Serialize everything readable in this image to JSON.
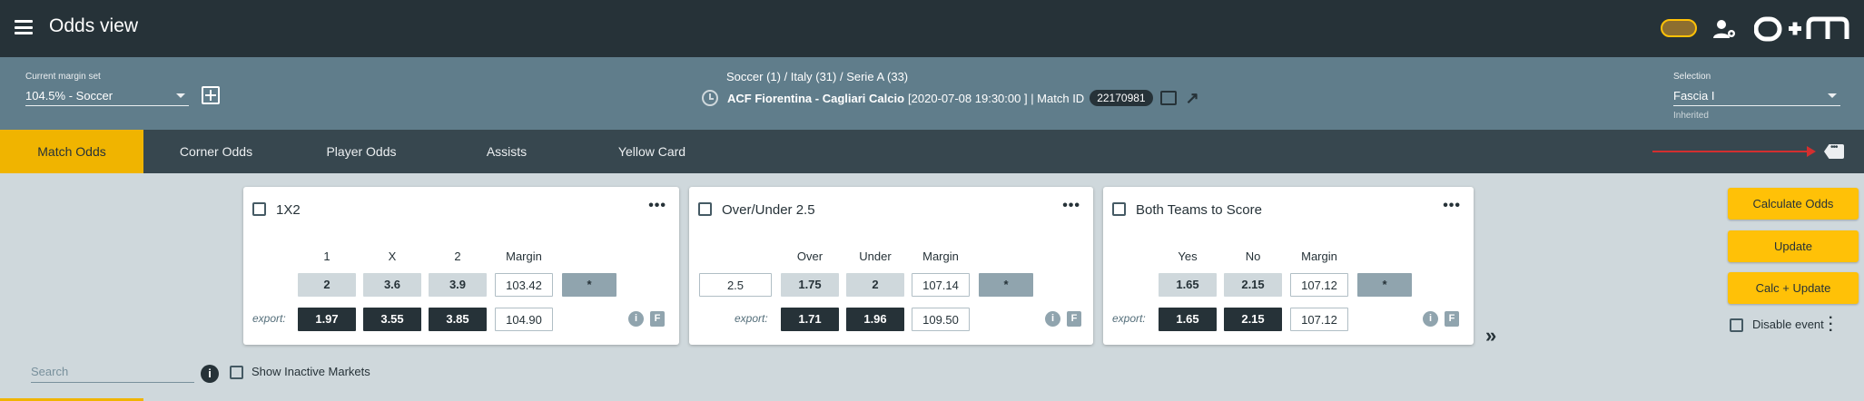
{
  "header": {
    "title": "Odds view",
    "logo_text": "O+M"
  },
  "infobar": {
    "margin_label": "Current margin set",
    "margin_value": "104.5% - Soccer",
    "breadcrumb": "Soccer (1) / Italy (31) / Serie A (33)",
    "match_name": "ACF Fiorentina - Cagliari Calcio",
    "match_date": "[2020-07-08 19:30:00 ] | Match ID",
    "match_id": "22170981",
    "selection_label": "Selection",
    "selection_value": "Fascia I",
    "selection_sub": "Inherited"
  },
  "tabs": [
    {
      "label": "Match Odds",
      "active": true
    },
    {
      "label": "Corner Odds",
      "active": false
    },
    {
      "label": "Player Odds",
      "active": false
    },
    {
      "label": "Assists",
      "active": false
    },
    {
      "label": "Yellow Card",
      "active": false
    }
  ],
  "markets": [
    {
      "title": "1X2",
      "headers": [
        "1",
        "X",
        "2",
        "Margin"
      ],
      "odds": [
        "2",
        "3.6",
        "3.9"
      ],
      "margin": "103.42",
      "export_label": "export:",
      "export_odds": [
        "1.97",
        "3.55",
        "3.85"
      ],
      "export_margin": "104.90",
      "star": "*"
    },
    {
      "title": "Over/Under 2.5",
      "line": "2.5",
      "headers": [
        "Over",
        "Under",
        "Margin"
      ],
      "odds": [
        "1.75",
        "2"
      ],
      "margin": "107.14",
      "export_label": "export:",
      "export_odds": [
        "1.71",
        "1.96"
      ],
      "export_margin": "109.50",
      "star": "*"
    },
    {
      "title": "Both Teams to Score",
      "headers": [
        "Yes",
        "No",
        "Margin"
      ],
      "odds": [
        "1.65",
        "2.15"
      ],
      "margin": "107.12",
      "export_label": "export:",
      "export_odds": [
        "1.65",
        "2.15"
      ],
      "export_margin": "107.12",
      "star": "*"
    }
  ],
  "actions": {
    "calculate": "Calculate Odds",
    "update": "Update",
    "calc_update": "Calc + Update",
    "disable_event": "Disable event"
  },
  "footer": {
    "search_placeholder": "Search",
    "show_inactive": "Show Inactive Markets"
  },
  "colors": {
    "accent": "#f0b400",
    "topbar": "#263238",
    "infobar": "#607d8b",
    "tabbar": "#37474f",
    "annotation_arrow": "#d32f2f"
  }
}
